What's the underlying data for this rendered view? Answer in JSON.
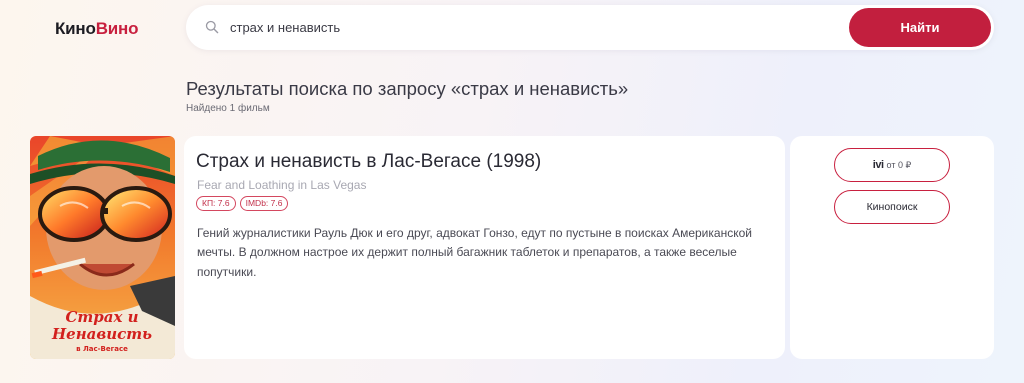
{
  "header": {
    "logo_part1": "Кино",
    "logo_part2": "Вино",
    "search": {
      "value": "страх и ненависть",
      "placeholder": "",
      "icon": "search-icon",
      "button_label": "Найти"
    }
  },
  "results": {
    "title": "Результаты поиска по запросу «страх и ненависть»",
    "count": "Найдено 1 фильм"
  },
  "films": [
    {
      "title": "Страх и ненависть в Лас-Вегасе (1998)",
      "original_title": "Fear and Loathing in Las Vegas",
      "ratings": [
        "КП: 7.6",
        "IMDb: 7.6"
      ],
      "description": "Гений журналистики Рауль Дюк и его друг, адвокат Гонзо, едут по пустыне в поисках Американской мечты. В должном настрое их держит полный багажник таблеток и препаратов, а также веселые попутчики.",
      "poster_text_line1": "Страх и",
      "poster_text_line2": "Ненависть",
      "poster_text_line3": "в Лас-Вегасе",
      "ivi_logo": "ivi",
      "ivi_price": "от 0 ₽",
      "kinopoisk_label": "Кинопоиск"
    }
  ],
  "colors": {
    "accent": "#c21f3e",
    "logo_accent": "#c8203f",
    "background_start": "#fdf6ee",
    "background_end": "#eef4fc"
  }
}
